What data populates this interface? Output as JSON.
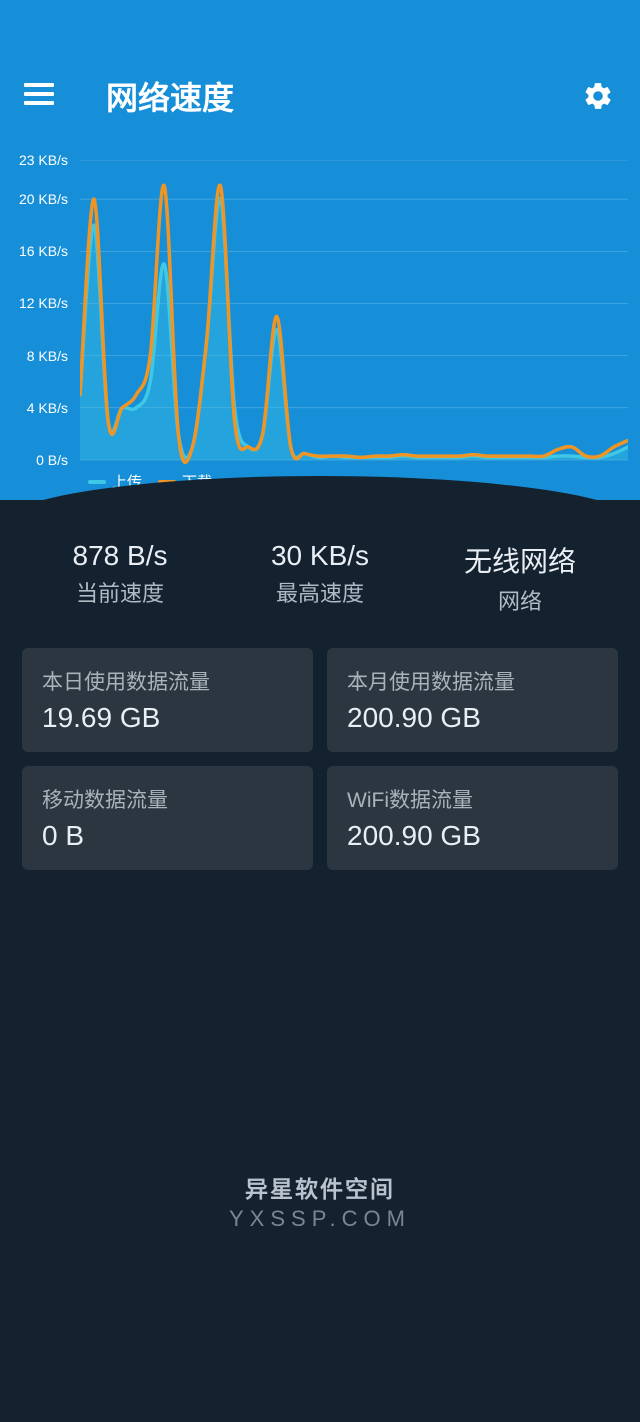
{
  "header": {
    "title": "网络速度"
  },
  "chart_data": {
    "type": "line",
    "title": "",
    "xlabel": "",
    "ylabel": "",
    "ylim": [
      0,
      23
    ],
    "y_ticks": [
      "23 KB/s",
      "20 KB/s",
      "16 KB/s",
      "12 KB/s",
      "8 KB/s",
      "4 KB/s",
      "0 B/s"
    ],
    "legend": [
      {
        "name": "上传",
        "color": "#3fc8e6"
      },
      {
        "name": "下载",
        "color": "#f09524"
      }
    ],
    "x": [
      0,
      1,
      2,
      3,
      4,
      5,
      6,
      7,
      8,
      9,
      10,
      11,
      12,
      13,
      14,
      15,
      16,
      17,
      18,
      19,
      20,
      21,
      22,
      23,
      24,
      25,
      26,
      27,
      28,
      29,
      30,
      31,
      32,
      33,
      34,
      35,
      36,
      37,
      38,
      39
    ],
    "series": [
      {
        "name": "上传",
        "color": "#3fc8e6",
        "values": [
          5,
          18,
          3,
          4,
          4,
          6,
          15,
          2,
          1,
          9,
          20,
          4,
          1,
          2,
          10,
          1,
          0.5,
          0.2,
          0.3,
          0.2,
          0.2,
          0.2,
          0.2,
          0.3,
          0.2,
          0.2,
          0.2,
          0.2,
          0.3,
          0.2,
          0.2,
          0.2,
          0.2,
          0.2,
          0.3,
          0.3,
          0.2,
          0.2,
          0.5,
          1
        ]
      },
      {
        "name": "下载",
        "color": "#f09524",
        "values": [
          5,
          20,
          3,
          4,
          5,
          8,
          21,
          2,
          1,
          9,
          21,
          3,
          1,
          2,
          11,
          1,
          0.5,
          0.3,
          0.3,
          0.3,
          0.2,
          0.3,
          0.3,
          0.4,
          0.3,
          0.3,
          0.3,
          0.3,
          0.4,
          0.3,
          0.3,
          0.3,
          0.3,
          0.3,
          0.8,
          1,
          0.3,
          0.3,
          1,
          1.5
        ]
      }
    ]
  },
  "stats": [
    {
      "value": "878 B/s",
      "label": "当前速度"
    },
    {
      "value": "30 KB/s",
      "label": "最高速度"
    },
    {
      "value": "无线网络",
      "label": "网络"
    }
  ],
  "cards": [
    {
      "label": "本日使用数据流量",
      "value": "19.69 GB"
    },
    {
      "label": "本月使用数据流量",
      "value": "200.90 GB"
    },
    {
      "label": "移动数据流量",
      "value": "0 B"
    },
    {
      "label": "WiFi数据流量",
      "value": "200.90 GB"
    }
  ],
  "watermark": {
    "title": "异星软件空间",
    "url": "YXSSP.COM"
  },
  "colors": {
    "header_bg": "#178fd8",
    "body_bg": "#14212e",
    "card_bg": "#2b3640"
  }
}
